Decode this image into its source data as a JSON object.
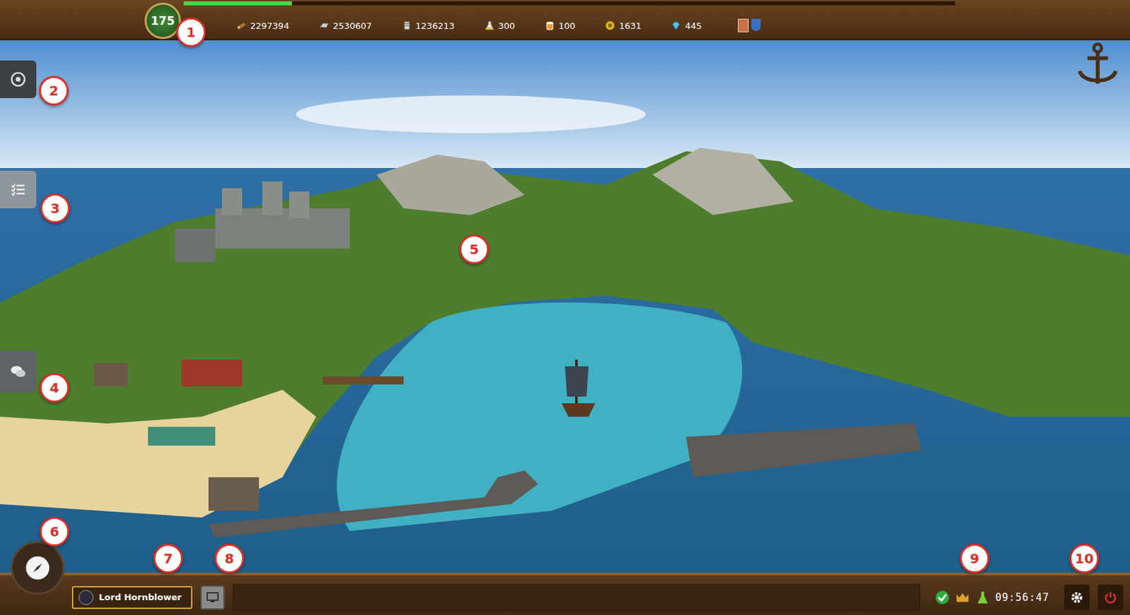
{
  "level": {
    "value": "175",
    "level": 0.14
  },
  "resources": [
    {
      "value": "2297394"
    },
    {
      "value": "2530607"
    },
    {
      "value": "1236213"
    },
    {
      "value": "300"
    },
    {
      "value": "100"
    },
    {
      "value": "1631"
    },
    {
      "value": "445"
    }
  ],
  "player": {
    "name": "Lord Hornblower"
  },
  "status": {
    "time": "09:56:47"
  },
  "callouts": [
    "1",
    "2",
    "3",
    "4",
    "5",
    "6",
    "7",
    "8",
    "9",
    "10"
  ]
}
